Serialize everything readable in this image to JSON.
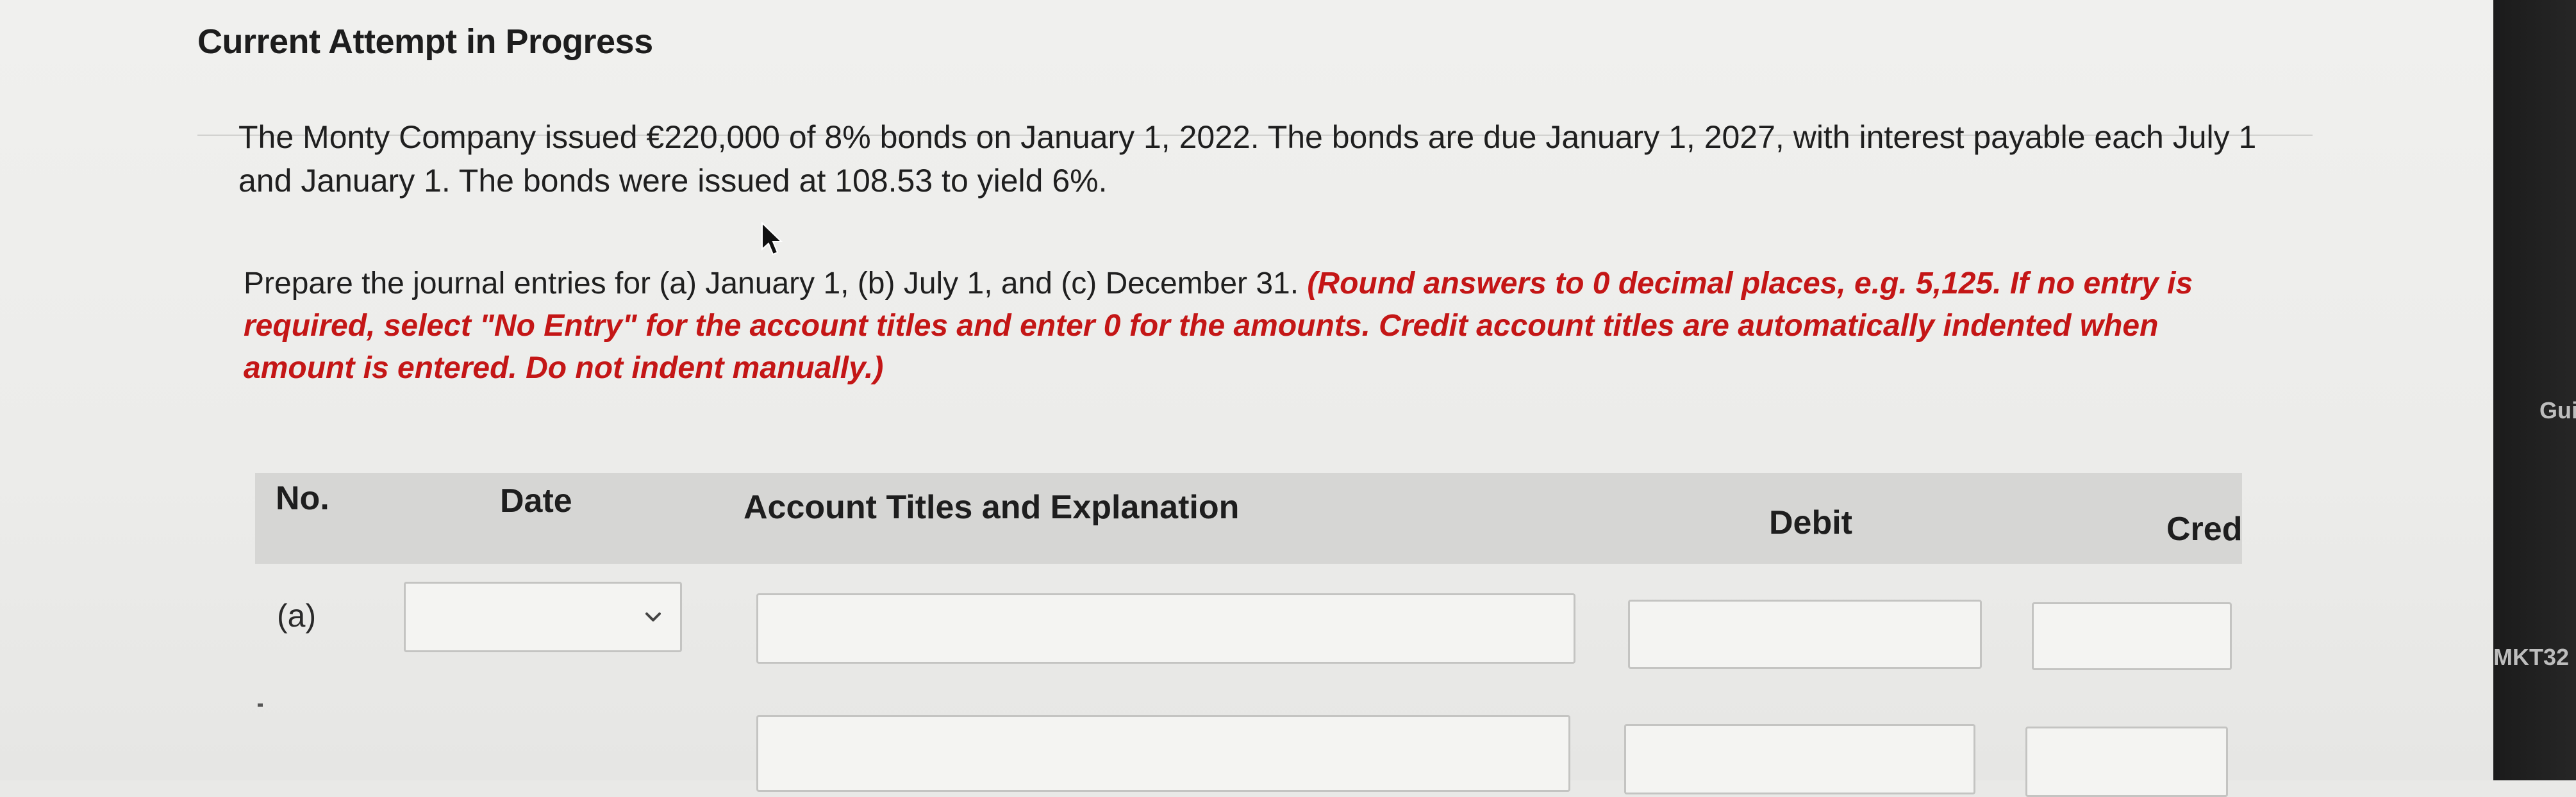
{
  "header": {
    "attempt_title": "Current Attempt in Progress"
  },
  "question": {
    "text": "The Monty Company issued €220,000 of 8% bonds on January 1, 2022. The bonds are due January 1, 2027, with interest payable each July 1 and January 1. The bonds were issued at 108.53 to yield 6%."
  },
  "instructions": {
    "prefix": "Prepare the journal entries for (a) January 1, (b) July 1, and (c) December 31. ",
    "note": "(Round answers to 0 decimal places, e.g. 5,125. If no entry is required, select \"No Entry\" for the account titles and enter 0 for the amounts. Credit account titles are automatically indented when amount is entered. Do not indent manually.)"
  },
  "table": {
    "headers": {
      "no": "No.",
      "date": "Date",
      "account": "Account Titles and Explanation",
      "debit": "Debit",
      "credit": "Cred"
    },
    "rows": [
      {
        "label": "(a)",
        "date_value": "",
        "account_value": "",
        "debit_value": "",
        "credit_value": ""
      },
      {
        "label": "",
        "account_value": "",
        "debit_value": "",
        "credit_value": ""
      }
    ]
  },
  "side_panel": {
    "top_text": "Gui",
    "bottom_text": "MKT32"
  },
  "icons": {
    "date_dropdown": "chevron-down-icon",
    "pointer": "mouse-pointer-icon"
  }
}
